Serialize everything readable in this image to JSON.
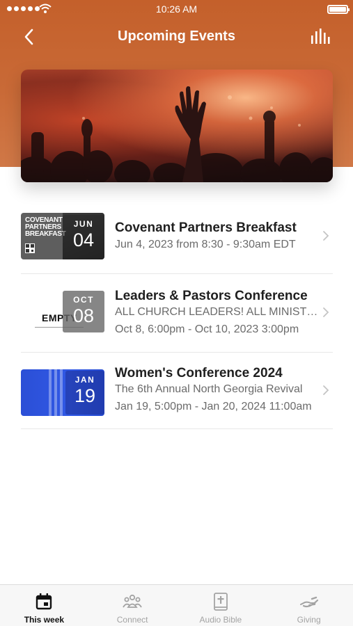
{
  "status_bar": {
    "time": "10:26 AM"
  },
  "header": {
    "title": "Upcoming Events",
    "back_icon": "chevron-left-icon",
    "action_icon": "bar-chart-icon"
  },
  "events": [
    {
      "title": "Covenant Partners Breakfast",
      "description": "",
      "date_text": "Jun 4, 2023 from 8:30 - 9:30am EDT",
      "badge_month": "JUN",
      "badge_day": "04",
      "thumb_title": "COVENANT PARTNERS BREAKFAST"
    },
    {
      "title": "Leaders & Pastors Conference",
      "description": "ALL CHURCH LEADERS! ALL MINISTRY TEAMS!",
      "date_text": "Oct 8, 6:00pm - Oct 10, 2023 3:00pm",
      "badge_month": "OCT",
      "badge_day": "08",
      "thumb_title": "EMPTY"
    },
    {
      "title": "Women's Conference 2024",
      "description": "The 6th Annual North Georgia Revival",
      "date_text": "Jan 19, 5:00pm - Jan 20, 2024 11:00am",
      "badge_month": "JAN",
      "badge_day": "19",
      "thumb_title": ""
    }
  ],
  "tabs": [
    {
      "label": "This week",
      "icon": "calendar-icon",
      "active": true
    },
    {
      "label": "Connect",
      "icon": "people-icon",
      "active": false
    },
    {
      "label": "Audio Bible",
      "icon": "bible-icon",
      "active": false
    },
    {
      "label": "Giving",
      "icon": "giving-hand-icon",
      "active": false
    }
  ],
  "colors": {
    "header": "#c96a37",
    "active_tab": "#111111",
    "inactive_tab": "#a3a3a3"
  }
}
